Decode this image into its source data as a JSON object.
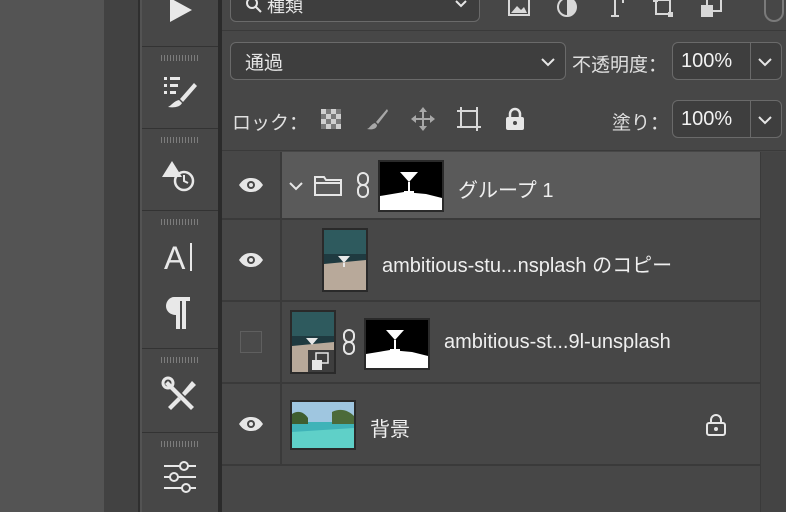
{
  "filter": {
    "kind_label": "種類"
  },
  "blend": {
    "mode": "通過",
    "opacity_label": "不透明度：",
    "opacity_value": "100%"
  },
  "lock": {
    "label": "ロック：",
    "fill_label": "塗り：",
    "fill_value": "100%"
  },
  "layers": [
    {
      "name": "グループ 1",
      "type": "group",
      "visible": true,
      "selected": true,
      "expanded": true,
      "has_mask": true
    },
    {
      "name": "ambitious-stu...nsplash のコピー",
      "type": "pixel",
      "visible": true,
      "selected": false,
      "has_mask": false
    },
    {
      "name": "ambitious-st...9l-unsplash",
      "type": "smart-object",
      "visible": false,
      "selected": false,
      "has_mask": true
    },
    {
      "name": "背景",
      "type": "background",
      "visible": true,
      "selected": false,
      "locked": true
    }
  ],
  "colors": {
    "panel": "#474747",
    "selected_row": "#5a5a5a",
    "text": "#efefef"
  }
}
